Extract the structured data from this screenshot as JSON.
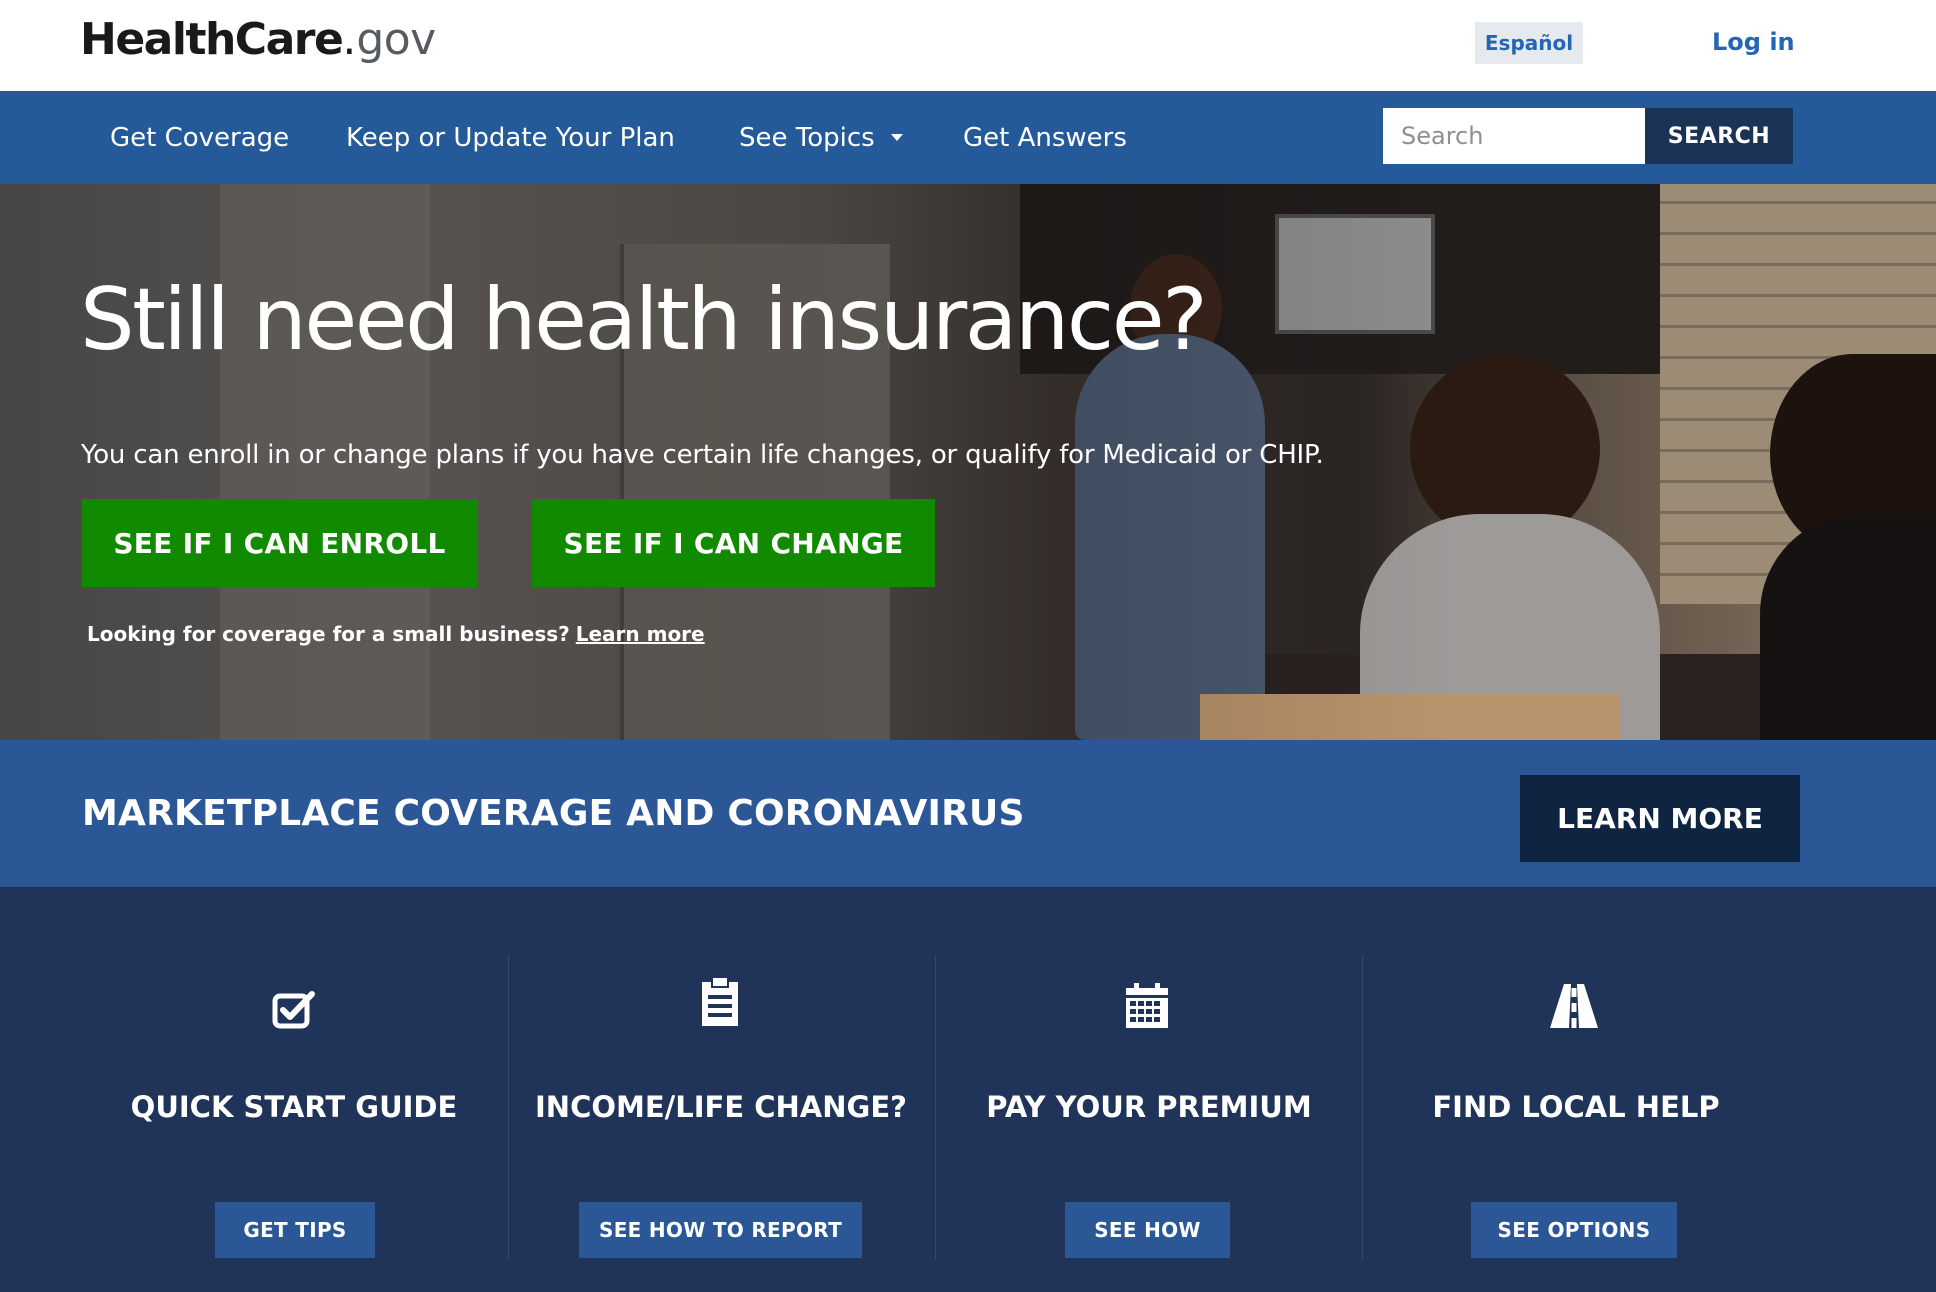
{
  "header": {
    "logo": {
      "health": "Health",
      "care": "Care",
      "dot": ".",
      "gov": "gov"
    },
    "language_button": "Español",
    "login_link": "Log in"
  },
  "nav": {
    "items": [
      {
        "label": "Get Coverage"
      },
      {
        "label": "Keep or Update Your Plan"
      },
      {
        "label": "See Topics",
        "has_dropdown": true
      },
      {
        "label": "Get Answers"
      }
    ],
    "search": {
      "placeholder": "Search",
      "button_label": "SEARCH"
    }
  },
  "hero": {
    "title": "Still need health insurance?",
    "subtitle": "You can enroll in or change plans if you have certain life changes, or qualify for Medicaid or CHIP.",
    "enroll_button": "SEE IF I CAN ENROLL",
    "change_button": "SEE IF I CAN CHANGE",
    "small_business_text": "Looking for coverage for a small business?",
    "small_business_link": "Learn more"
  },
  "banner": {
    "title": "MARKETPLACE COVERAGE AND CORONAVIRUS",
    "button": "LEARN MORE"
  },
  "cards": [
    {
      "icon": "checkbox-icon",
      "title": "QUICK START GUIDE",
      "button": "GET TIPS"
    },
    {
      "icon": "clipboard-icon",
      "title": "INCOME/LIFE CHANGE?",
      "button": "SEE HOW TO REPORT"
    },
    {
      "icon": "calendar-icon",
      "title": "PAY YOUR PREMIUM",
      "button": "SEE HOW"
    },
    {
      "icon": "road-icon",
      "title": "FIND LOCAL HELP",
      "button": "SEE OPTIONS"
    }
  ],
  "colors": {
    "brand_blue": "#2466b5",
    "nav_blue": "#255a9a",
    "green": "#118a00",
    "banner_blue": "#2b5797",
    "dark_navy": "#1f3458",
    "button_navy": "#0f2440"
  }
}
